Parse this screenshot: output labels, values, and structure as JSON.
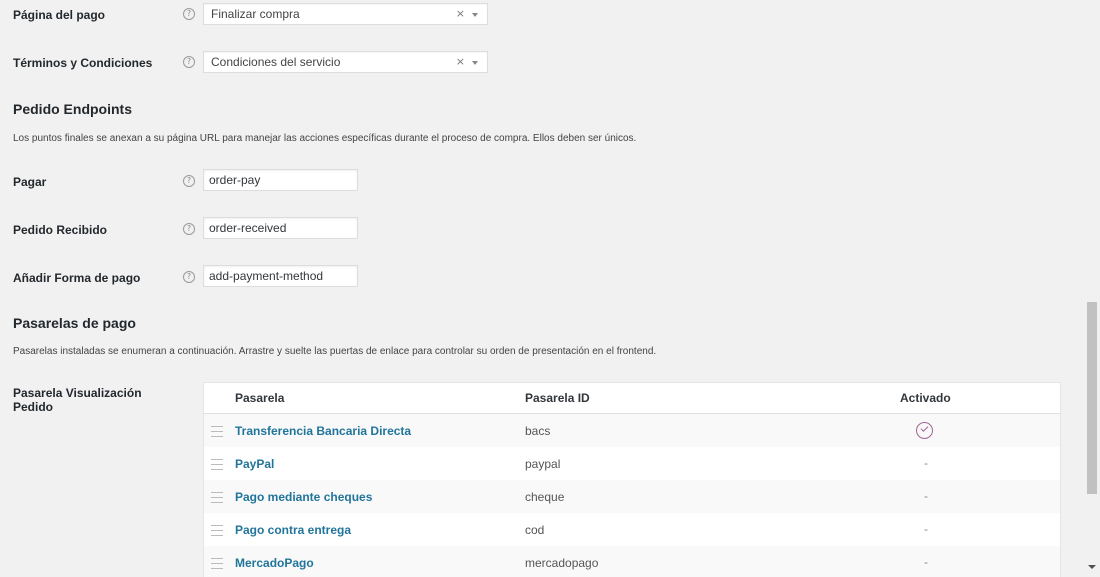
{
  "checkout": {
    "payment_page": {
      "label": "Página del pago",
      "value": "Finalizar compra"
    },
    "terms": {
      "label": "Términos y Condiciones",
      "value": "Condiciones del servicio"
    }
  },
  "endpoints": {
    "title": "Pedido Endpoints",
    "description": "Los puntos finales se anexan a su página URL para manejar las acciones específicas durante el proceso de compra. Ellos deben ser únicos.",
    "fields": [
      {
        "label": "Pagar",
        "value": "order-pay"
      },
      {
        "label": "Pedido Recibido",
        "value": "order-received"
      },
      {
        "label": "Añadir Forma de pago",
        "value": "add-payment-method"
      }
    ]
  },
  "gateways": {
    "title": "Pasarelas de pago",
    "description": "Pasarelas instaladas se enumeran a continuación. Arrastre y suelte las puertas de enlace para controlar su orden de presentación en el frontend.",
    "order_label": "Pasarela Visualización Pedido",
    "columns": [
      "Pasarela",
      "Pasarela ID",
      "Activado"
    ],
    "rows": [
      {
        "name": "Transferencia Bancaria Directa",
        "id": "bacs",
        "enabled": true,
        "status": ""
      },
      {
        "name": "PayPal",
        "id": "paypal",
        "enabled": false,
        "status": "-"
      },
      {
        "name": "Pago mediante cheques",
        "id": "cheque",
        "enabled": false,
        "status": "-"
      },
      {
        "name": "Pago contra entrega",
        "id": "cod",
        "enabled": false,
        "status": "-"
      },
      {
        "name": "MercadoPago",
        "id": "mercadopago",
        "enabled": false,
        "status": "-"
      }
    ]
  },
  "icons": {
    "help": "?",
    "clear": "×"
  },
  "colors": {
    "link": "#21759b",
    "enabled_check": "#a46497",
    "background": "#f1f1f1"
  }
}
